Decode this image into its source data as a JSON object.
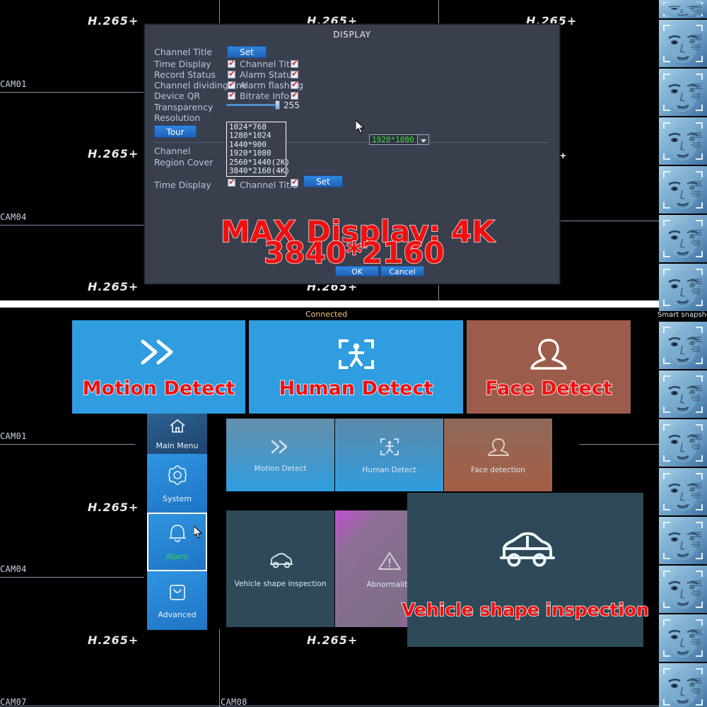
{
  "dialog": {
    "title": "DISPLAY",
    "rows": {
      "channel_title": "Channel Title",
      "time_display": "Time Display",
      "record_status": "Record Status",
      "channel_dividing_line": "Channel dividing line",
      "device_qr": "Device QR",
      "transparency": "Transparency",
      "resolution": "Resolution",
      "channel": "Channel",
      "region_cover": "Region Cover",
      "time_display2": "Time Display"
    },
    "checks": {
      "channel_title": "Channel Title",
      "alarm_status": "Alarm Status",
      "alarm_flashing": "Alarm flashing",
      "bitrate_info": "Bitrate Info",
      "channel_title2": "Channel Title"
    },
    "set_label": "Set",
    "set_label2": "Set",
    "tour_label": "Tour",
    "transparency_value": "255",
    "resolution_value": "1920*1080",
    "resolution_options": [
      "1024*768",
      "1280*1024",
      "1440*900",
      "1920*1080",
      "2560*1440(2K)",
      "3840*2160(4K)"
    ],
    "ok_label": "OK",
    "cancel_label": "Cancel",
    "overlay_line1": "MAX Display: 4K",
    "overlay_line2": "3840*2160"
  },
  "video_wall": {
    "codec_badge": "H.265+",
    "cam_labels": [
      "CAM01",
      "CAM04",
      "CAM01",
      "CAM04",
      "CAM07",
      "CAM08"
    ]
  },
  "rail": {
    "label": "Smart snapshot"
  },
  "banners": [
    {
      "label": "Motion Detect",
      "icon": "double-chevron-right-icon",
      "color": "#2f9ddf"
    },
    {
      "label": "Human Detect",
      "icon": "human-detect-icon",
      "color": "#2f9ddf"
    },
    {
      "label": "Face Detect",
      "icon": "face-detect-icon",
      "color": "#9c5c4c"
    }
  ],
  "alarm_menu": {
    "connected": "Connected",
    "sidebar": [
      {
        "label": "Main Menu",
        "icon": "home-icon"
      },
      {
        "label": "System",
        "icon": "gear-icon"
      },
      {
        "label": "Alarm",
        "icon": "bell-icon"
      },
      {
        "label": "Advanced",
        "icon": "advanced-icon"
      }
    ],
    "tiles": [
      {
        "label": "Motion Detect",
        "icon": "double-chevron-right-icon"
      },
      {
        "label": "Human Detect",
        "icon": "human-detect-icon"
      },
      {
        "label": "Face detection",
        "icon": "face-detect-icon"
      },
      {
        "label": "Vehicle shape inspection",
        "icon": "car-icon"
      },
      {
        "label": "Abnormality",
        "icon": "warning-triangle-icon"
      }
    ],
    "popcard": {
      "label": "Vehicle shape inspection",
      "icon": "car-icon"
    }
  }
}
